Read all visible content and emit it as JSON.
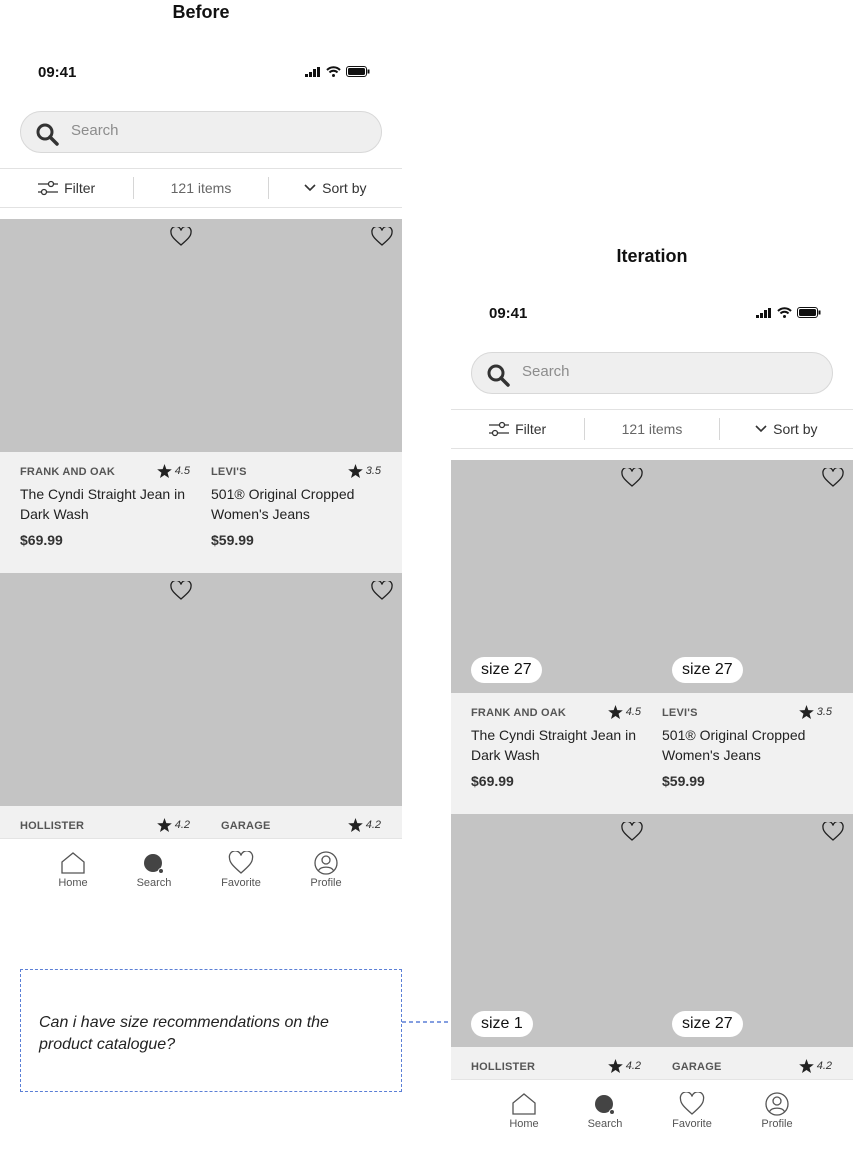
{
  "before": {
    "heading": "Before",
    "status_time": "09:41",
    "search_placeholder": "Search",
    "filter_label": "Filter",
    "item_count": "121 items",
    "sort_label": "Sort by",
    "products": [
      {
        "brand": "FRANK AND OAK",
        "rating": "4.5",
        "name": "The Cyndi Straight Jean in Dark Wash",
        "price": "$69.99"
      },
      {
        "brand": "LEVI'S",
        "rating": "3.5",
        "name": "501® Original Cropped Women's Jeans",
        "price": "$59.99"
      },
      {
        "brand": "HOLLISTER",
        "rating": "4.2"
      },
      {
        "brand": "GARAGE",
        "rating": "4.2"
      }
    ],
    "tabs": [
      "Home",
      "Search",
      "Favorite",
      "Profile"
    ]
  },
  "iteration": {
    "heading": "Iteration",
    "status_time": "09:41",
    "search_placeholder": "Search",
    "filter_label": "Filter",
    "item_count": "121 items",
    "sort_label": "Sort by",
    "products": [
      {
        "size": "size 27",
        "brand": "FRANK AND OAK",
        "rating": "4.5",
        "name": "The Cyndi Straight Jean in Dark Wash",
        "price": "$69.99"
      },
      {
        "size": "size 27",
        "brand": "LEVI'S",
        "rating": "3.5",
        "name": "501® Original Cropped Women's Jeans",
        "price": "$59.99"
      },
      {
        "size": "size 1",
        "brand": "HOLLISTER",
        "rating": "4.2"
      },
      {
        "size": "size 27",
        "brand": "GARAGE",
        "rating": "4.2"
      }
    ],
    "tabs": [
      "Home",
      "Search",
      "Favorite",
      "Profile"
    ]
  },
  "note": "Can i have size recommendations on the product catalogue?",
  "colors": {
    "placeholder_gray": "#c4c4c4",
    "card_bg": "#f1f1f1",
    "annotation_blue": "#5b7fd6"
  }
}
